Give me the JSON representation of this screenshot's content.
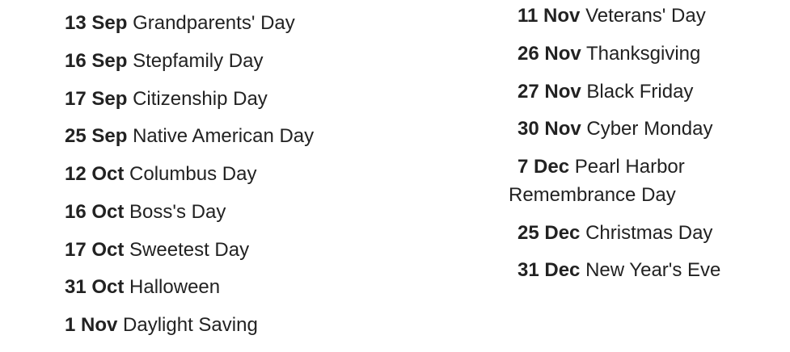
{
  "left_column": [
    {
      "date": "13 Sep",
      "name": "Grandparents' Day"
    },
    {
      "date": "16 Sep",
      "name": "Stepfamily Day"
    },
    {
      "date": "17 Sep",
      "name": "Citizenship Day"
    },
    {
      "date": "25 Sep",
      "name": "Native American Day"
    },
    {
      "date": "12 Oct",
      "name": "Columbus Day"
    },
    {
      "date": "16 Oct",
      "name": "Boss's Day"
    },
    {
      "date": "17 Oct",
      "name": "Sweetest Day"
    },
    {
      "date": "31 Oct",
      "name": "Halloween"
    },
    {
      "date": "1 Nov",
      "name": "Daylight Saving"
    }
  ],
  "right_column": [
    {
      "date": "11 Nov",
      "name": "Veterans' Day"
    },
    {
      "date": "26 Nov",
      "name": "Thanksgiving"
    },
    {
      "date": "27 Nov",
      "name": "Black Friday"
    },
    {
      "date": "30 Nov",
      "name": "Cyber Monday"
    },
    {
      "date": "7 Dec",
      "name": "Pearl Harbor Remembrance Day"
    },
    {
      "date": "25 Dec",
      "name": "Christmas Day"
    },
    {
      "date": "31 Dec",
      "name": "New Year's Eve"
    }
  ]
}
